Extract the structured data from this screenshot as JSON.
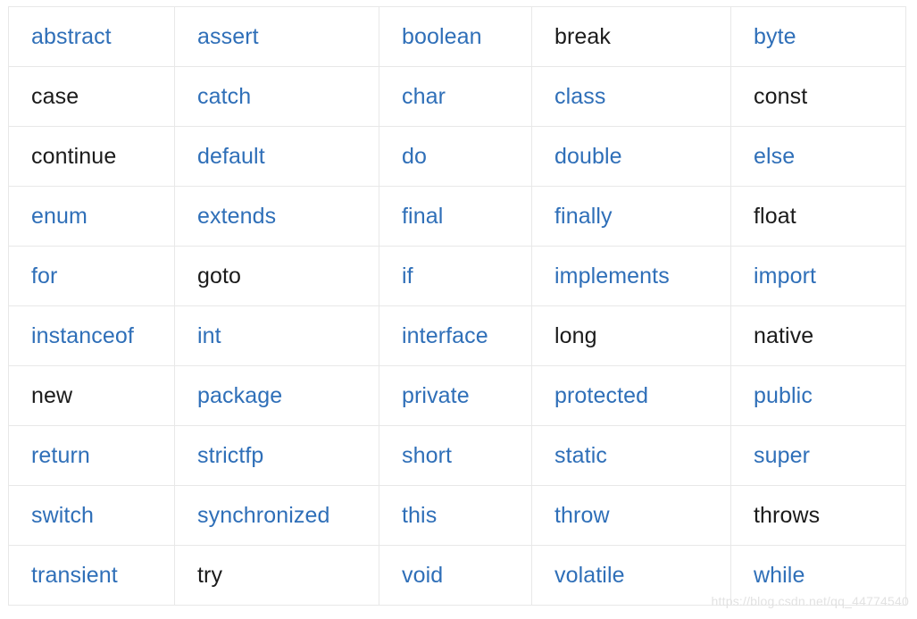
{
  "page": {
    "title": "Java Keywords Table",
    "background_color": "#ffffff"
  },
  "colors": {
    "link": "#2f6fb8",
    "plain_text": "#1b1b1b",
    "cell_border": "#e8e8e8",
    "watermark": "#e2e2e2"
  },
  "watermark": {
    "text": "https://blog.csdn.net/qq_44774540"
  },
  "table": {
    "columns": 5,
    "rows_count": 10,
    "rows": [
      [
        {
          "label": "abstract",
          "style": "link"
        },
        {
          "label": "assert",
          "style": "link"
        },
        {
          "label": "boolean",
          "style": "link"
        },
        {
          "label": "break",
          "style": "plain"
        },
        {
          "label": "byte",
          "style": "link"
        }
      ],
      [
        {
          "label": "case",
          "style": "plain"
        },
        {
          "label": "catch",
          "style": "link"
        },
        {
          "label": "char",
          "style": "link"
        },
        {
          "label": "class",
          "style": "link"
        },
        {
          "label": "const",
          "style": "plain"
        }
      ],
      [
        {
          "label": "continue",
          "style": "plain"
        },
        {
          "label": "default",
          "style": "link"
        },
        {
          "label": "do",
          "style": "link"
        },
        {
          "label": "double",
          "style": "link"
        },
        {
          "label": "else",
          "style": "link"
        }
      ],
      [
        {
          "label": "enum",
          "style": "link"
        },
        {
          "label": "extends",
          "style": "link"
        },
        {
          "label": "final",
          "style": "link"
        },
        {
          "label": "finally",
          "style": "link"
        },
        {
          "label": "float",
          "style": "plain"
        }
      ],
      [
        {
          "label": "for",
          "style": "link"
        },
        {
          "label": "goto",
          "style": "plain"
        },
        {
          "label": "if",
          "style": "link"
        },
        {
          "label": "implements",
          "style": "link"
        },
        {
          "label": "import",
          "style": "link"
        }
      ],
      [
        {
          "label": "instanceof",
          "style": "link"
        },
        {
          "label": "int",
          "style": "link"
        },
        {
          "label": "interface",
          "style": "link"
        },
        {
          "label": "long",
          "style": "plain"
        },
        {
          "label": "native",
          "style": "plain"
        }
      ],
      [
        {
          "label": "new",
          "style": "plain"
        },
        {
          "label": "package",
          "style": "link"
        },
        {
          "label": "private",
          "style": "link"
        },
        {
          "label": "protected",
          "style": "link"
        },
        {
          "label": "public",
          "style": "link"
        }
      ],
      [
        {
          "label": "return",
          "style": "link"
        },
        {
          "label": "strictfp",
          "style": "link"
        },
        {
          "label": "short",
          "style": "link"
        },
        {
          "label": "static",
          "style": "link"
        },
        {
          "label": "super",
          "style": "link"
        }
      ],
      [
        {
          "label": "switch",
          "style": "link"
        },
        {
          "label": "synchronized",
          "style": "link"
        },
        {
          "label": "this",
          "style": "link"
        },
        {
          "label": "throw",
          "style": "link"
        },
        {
          "label": "throws",
          "style": "plain"
        }
      ],
      [
        {
          "label": "transient",
          "style": "link"
        },
        {
          "label": "try",
          "style": "plain"
        },
        {
          "label": "void",
          "style": "link"
        },
        {
          "label": "volatile",
          "style": "link"
        },
        {
          "label": "while",
          "style": "link"
        }
      ]
    ]
  }
}
